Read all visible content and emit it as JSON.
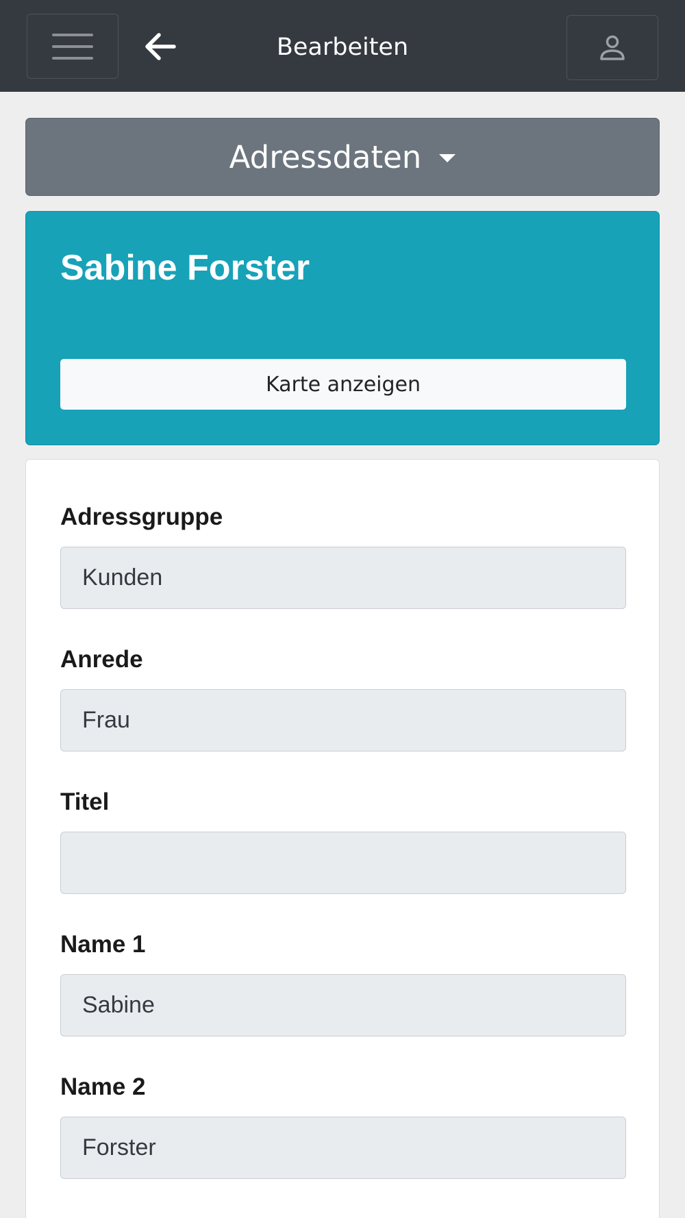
{
  "header": {
    "title": "Bearbeiten",
    "icons": {
      "menu": "hamburger-menu-icon",
      "back": "arrow-left-icon",
      "user": "user-icon"
    }
  },
  "section": {
    "label": "Adressdaten"
  },
  "contact": {
    "name": "Sabine Forster",
    "map_button": "Karte anzeigen"
  },
  "form": {
    "fields": [
      {
        "label": "Adressgruppe",
        "value": "Kunden"
      },
      {
        "label": "Anrede",
        "value": "Frau"
      },
      {
        "label": "Titel",
        "value": ""
      },
      {
        "label": "Name 1",
        "value": "Sabine"
      },
      {
        "label": "Name 2",
        "value": "Forster"
      }
    ]
  },
  "colors": {
    "topbar": "#343a40",
    "dropdown": "#6c757d",
    "info": "#17a2b8",
    "input_bg": "#e9ecef"
  }
}
